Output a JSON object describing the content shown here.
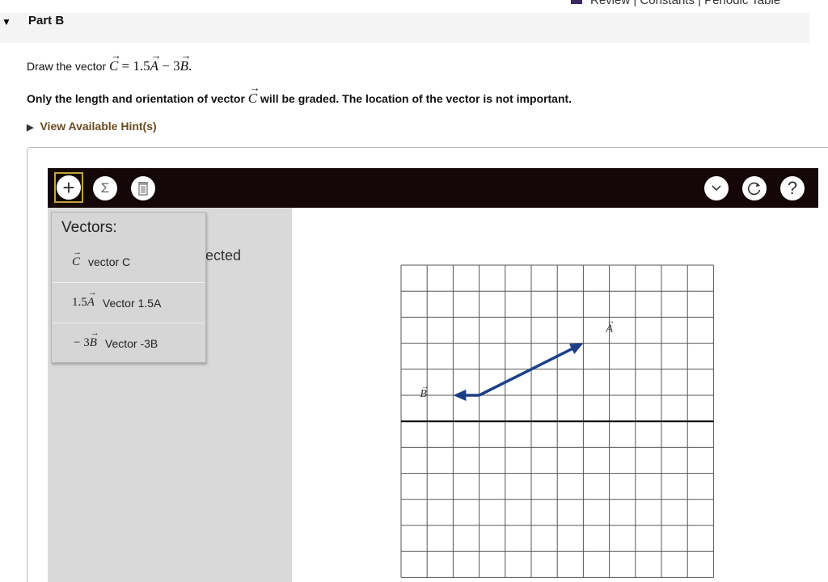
{
  "top_links": {
    "text": "Review | Constants | Periodic Table"
  },
  "part": {
    "title": "Part B"
  },
  "question": {
    "prompt": "Draw the vector",
    "equation_lhs": "C",
    "equation_rhs_a": "= 1.5",
    "equation_a": "A",
    "equation_rhs_b": " − 3",
    "equation_b": "B",
    "equation_end": ".",
    "note_before": "Only the length and orientation of vector",
    "note_vector": "C",
    "note_after": "will be graded. The location of the vector is not important."
  },
  "hint": {
    "label": "View Available Hint(s)"
  },
  "toolbar": {
    "add_icon": "+",
    "sum_icon": "Σ",
    "help_icon": "?"
  },
  "panel": {
    "selected_text": "ected"
  },
  "dropdown": {
    "title": "Vectors:",
    "items": [
      {
        "sym_coef": "",
        "sym_var": "C",
        "label": "vector C"
      },
      {
        "sym_coef": "1.5",
        "sym_var": "A",
        "label": "Vector 1.5A"
      },
      {
        "sym_coef": "− 3",
        "sym_var": "B",
        "label": "Vector -3B"
      }
    ]
  },
  "graph": {
    "label_a": "A",
    "label_b": "B",
    "vector_color": "#1b3f85",
    "vector_a": {
      "from": [
        3,
        1
      ],
      "to": [
        7,
        3
      ]
    },
    "vector_b": {
      "from": [
        3,
        1
      ],
      "to": [
        2,
        1
      ]
    }
  }
}
